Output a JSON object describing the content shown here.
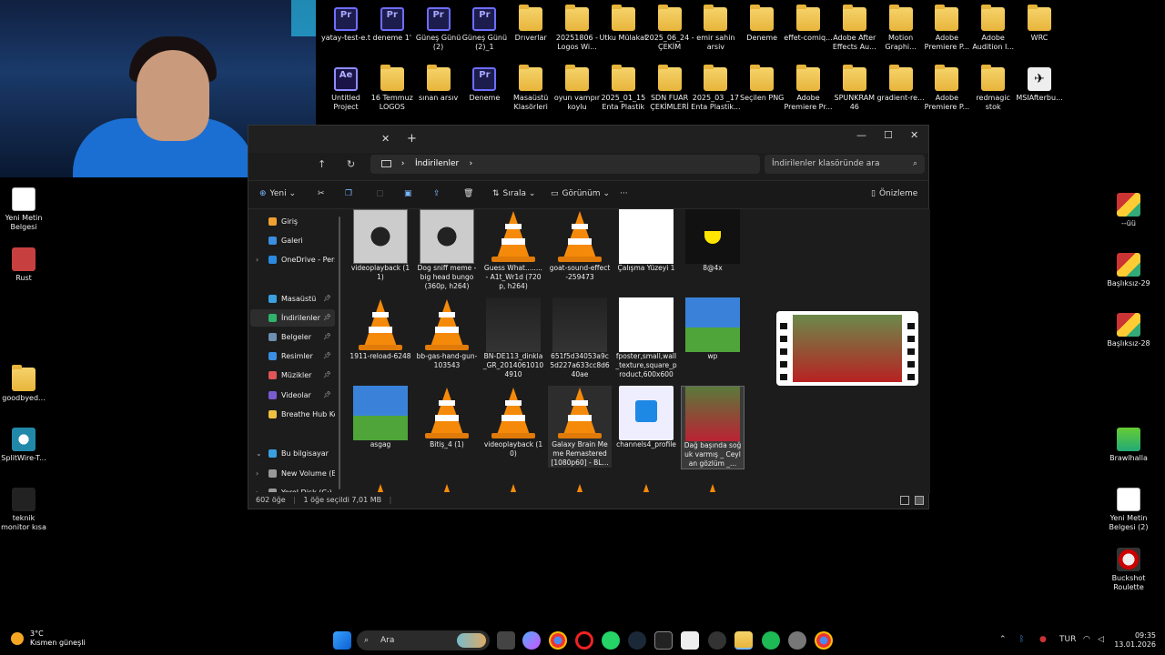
{
  "desktop": {
    "top_row1": [
      {
        "label": "yatay-test-e.t",
        "type": "pr"
      },
      {
        "label": "deneme 1'",
        "type": "pr"
      },
      {
        "label": "Güneş Günü (2)",
        "type": "pr"
      },
      {
        "label": "Güneş Günü (2)_1",
        "type": "pr"
      },
      {
        "label": "Drıverlar",
        "type": "folder"
      },
      {
        "label": "20251806 -Logos Wi...",
        "type": "folder"
      },
      {
        "label": "Utku Mülakat",
        "type": "folder"
      },
      {
        "label": "2025_06_24 - ÇEKİM",
        "type": "folder"
      },
      {
        "label": "emir sahin arsiv",
        "type": "folder"
      },
      {
        "label": "Deneme",
        "type": "folder"
      },
      {
        "label": "effet-comiq...",
        "type": "folder"
      },
      {
        "label": "Adobe After Effects Au...",
        "type": "folder"
      },
      {
        "label": "Motion Graphi...",
        "type": "folder"
      },
      {
        "label": "Adobe Premiere P...",
        "type": "folder"
      },
      {
        "label": "Adobe Audition I...",
        "type": "folder"
      },
      {
        "label": "WRC",
        "type": "folder"
      }
    ],
    "top_row2": [
      {
        "label": "Untitled Project",
        "type": "ae"
      },
      {
        "label": "16 Temmuz LOGOS",
        "type": "folder"
      },
      {
        "label": "sınan arsıv",
        "type": "folder"
      },
      {
        "label": "Deneme",
        "type": "pr"
      },
      {
        "label": "Masaüstü Klasörleri",
        "type": "folder"
      },
      {
        "label": "oyun vampır koylu",
        "type": "folder"
      },
      {
        "label": "2025_01_15 Enta Plastik",
        "type": "folder"
      },
      {
        "label": "SDN FUAR ÇEKİMLERİ",
        "type": "folder"
      },
      {
        "label": "2025_03 _17 Enta Plastik...",
        "type": "folder"
      },
      {
        "label": "Seçilen PNG",
        "type": "folder"
      },
      {
        "label": "Adobe Premiere Pr...",
        "type": "folder"
      },
      {
        "label": "SPUNKRAM 46",
        "type": "folder"
      },
      {
        "label": "gradient-re...",
        "type": "folder"
      },
      {
        "label": "Adobe Premiere P...",
        "type": "folder"
      },
      {
        "label": "redmagic stok",
        "type": "folder"
      },
      {
        "label": "MSIAfterbu...",
        "type": "msi"
      }
    ],
    "left": [
      {
        "label": "Yeni Metin Belgesi",
        "type": "doc"
      },
      {
        "label": "Rust",
        "type": "app"
      },
      {
        "label": "goodbyed...",
        "type": "folder"
      },
      {
        "label": "SplitWire-T...",
        "type": "split"
      },
      {
        "label": "teknik monitor kısa",
        "type": "webcam"
      }
    ],
    "right": [
      {
        "label": "--üü",
        "type": "img"
      },
      {
        "label": "Başlıksız-29",
        "type": "img"
      },
      {
        "label": "Başlıksız-28",
        "type": "img"
      },
      {
        "label": "Brawlhalla",
        "type": "green"
      },
      {
        "label": "Yeni Metin Belgesi (2)",
        "type": "doc"
      },
      {
        "label": "Buckshot Roulette",
        "type": "roulette"
      }
    ]
  },
  "explorer": {
    "address": "İndirilenler",
    "search_placeholder": "İndirilenler klasöründe ara",
    "toolbar": {
      "new": "Yeni",
      "sort": "Sırala",
      "view": "Görünüm",
      "more": "···",
      "preview": "Önizleme"
    },
    "sidebar": [
      {
        "label": "Giriş",
        "color": "#f0a030",
        "pin": false
      },
      {
        "label": "Galeri",
        "color": "#3a8fe0",
        "pin": false
      },
      {
        "label": "OneDrive - Perso",
        "color": "#2b8ae0",
        "pin": false,
        "chev": true
      },
      {
        "label": "Masaüstü",
        "color": "#3aa0e0",
        "pin": true
      },
      {
        "label": "İndirilenler",
        "color": "#2fb36b",
        "pin": true,
        "active": true
      },
      {
        "label": "Belgeler",
        "color": "#6e8fb0",
        "pin": true
      },
      {
        "label": "Resimler",
        "color": "#3a8fe0",
        "pin": true
      },
      {
        "label": "Müzikler",
        "color": "#e05555",
        "pin": true
      },
      {
        "label": "Videolar",
        "color": "#7a5bd0",
        "pin": true
      },
      {
        "label": "Breathe Hub Kon",
        "color": "#f0c040",
        "pin": false
      },
      {
        "label": "Bu bilgisayar",
        "color": "#3aa0e0",
        "pin": false,
        "chev": true
      },
      {
        "label": "New Volume (E",
        "color": "#999",
        "pin": false,
        "chev": true
      },
      {
        "label": "Yerel Disk (C:)",
        "color": "#999",
        "pin": false,
        "chev": true
      }
    ],
    "files": [
      {
        "label": "videoplayback (11)",
        "thumb": "video"
      },
      {
        "label": "Dog sniff meme - big head bungo (360p, h264)",
        "thumb": "video"
      },
      {
        "label": "Guess What........ - A1t_Wr1d (720p, h264)",
        "thumb": "vlc"
      },
      {
        "label": "goat-sound-effect-259473",
        "thumb": "vlc"
      },
      {
        "label": "Çalışma Yüzeyi 1",
        "thumb": "white"
      },
      {
        "label": "8@4x",
        "thumb": "yellow"
      },
      {
        "label": "1911-reload-6248",
        "thumb": "vlc"
      },
      {
        "label": "bb-gas-hand-gun-103543",
        "thumb": "vlc"
      },
      {
        "label": "BN-DE113_dinkla_GR_20140610104910",
        "thumb": "portrait"
      },
      {
        "label": "651f5d34053a9c5d227a633cc8d640ae",
        "thumb": "portrait"
      },
      {
        "label": "fposter,small,wall_texture,square_product,600x600",
        "thumb": "white"
      },
      {
        "label": "wp",
        "thumb": "xp"
      },
      {
        "label": "asgag",
        "thumb": "xp"
      },
      {
        "label": "Bitiş_4 (1)",
        "thumb": "vlc"
      },
      {
        "label": "videoplayback (10)",
        "thumb": "vlc"
      },
      {
        "label": "Galaxy Brain Meme Remastered [1080p60] - BL...",
        "thumb": "vlc",
        "hover": true
      },
      {
        "label": "channels4_profile",
        "thumb": "doc"
      },
      {
        "label": "Dağ başında soğuk varmış _ Ceylan gözlüm _...",
        "thumb": "boy",
        "selected": true
      }
    ],
    "status": {
      "count": "602 öğe",
      "selected": "1 öğe seçildi 7,01 MB"
    }
  },
  "weather": {
    "temp": "3°C",
    "desc": "Kısmen güneşli"
  },
  "taskbar": {
    "search": "Ara",
    "lang": "TUR",
    "time": "09:35",
    "date": "13.01.2026"
  }
}
